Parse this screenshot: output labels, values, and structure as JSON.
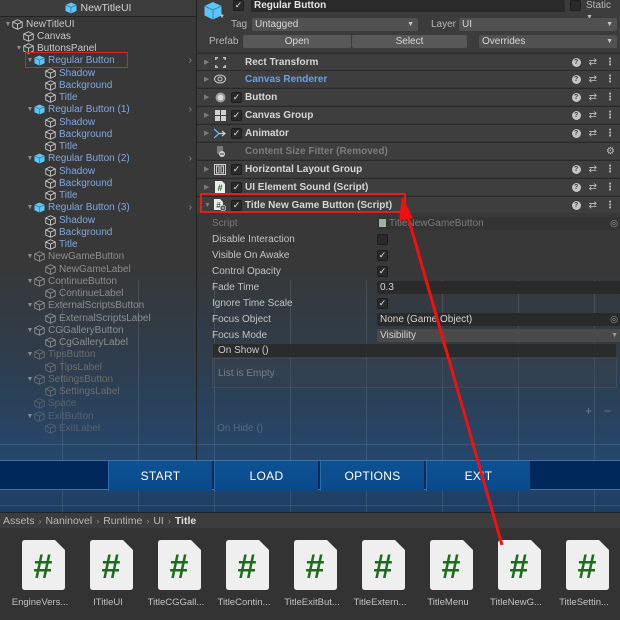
{
  "hierarchy": {
    "scene_title": "NewTitleUI",
    "items": [
      {
        "label": "NewTitleUI",
        "depth": 0,
        "arrow": true,
        "style": "normal"
      },
      {
        "label": "Canvas",
        "depth": 1,
        "arrow": false,
        "style": "normal"
      },
      {
        "label": "ButtonsPanel",
        "depth": 1,
        "arrow": true,
        "style": "normal"
      },
      {
        "label": "Regular Button",
        "depth": 2,
        "arrow": true,
        "style": "prefab",
        "chevron": true,
        "selected": true
      },
      {
        "label": "Shadow",
        "depth": 3,
        "arrow": false,
        "style": "prefab-child"
      },
      {
        "label": "Background",
        "depth": 3,
        "arrow": false,
        "style": "prefab-child"
      },
      {
        "label": "Title",
        "depth": 3,
        "arrow": false,
        "style": "prefab-child"
      },
      {
        "label": "Regular Button (1)",
        "depth": 2,
        "arrow": true,
        "style": "prefab",
        "chevron": true
      },
      {
        "label": "Shadow",
        "depth": 3,
        "arrow": false,
        "style": "prefab-child"
      },
      {
        "label": "Background",
        "depth": 3,
        "arrow": false,
        "style": "prefab-child"
      },
      {
        "label": "Title",
        "depth": 3,
        "arrow": false,
        "style": "prefab-child"
      },
      {
        "label": "Regular Button (2)",
        "depth": 2,
        "arrow": true,
        "style": "prefab",
        "chevron": true
      },
      {
        "label": "Shadow",
        "depth": 3,
        "arrow": false,
        "style": "prefab-child"
      },
      {
        "label": "Background",
        "depth": 3,
        "arrow": false,
        "style": "prefab-child"
      },
      {
        "label": "Title",
        "depth": 3,
        "arrow": false,
        "style": "prefab-child"
      },
      {
        "label": "Regular Button (3)",
        "depth": 2,
        "arrow": true,
        "style": "prefab",
        "chevron": true
      },
      {
        "label": "Shadow",
        "depth": 3,
        "arrow": false,
        "style": "prefab-child"
      },
      {
        "label": "Background",
        "depth": 3,
        "arrow": false,
        "style": "prefab-child"
      },
      {
        "label": "Title",
        "depth": 3,
        "arrow": false,
        "style": "prefab-child"
      },
      {
        "label": "NewGameButton",
        "depth": 2,
        "arrow": true,
        "style": "dim"
      },
      {
        "label": "NewGameLabel",
        "depth": 3,
        "arrow": false,
        "style": "dim"
      },
      {
        "label": "ContinueButton",
        "depth": 2,
        "arrow": true,
        "style": "dim"
      },
      {
        "label": "ContinueLabel",
        "depth": 3,
        "arrow": false,
        "style": "dim"
      },
      {
        "label": "ExternalScriptsButton",
        "depth": 2,
        "arrow": true,
        "style": "dim"
      },
      {
        "label": "ExternalScriptsLabel",
        "depth": 3,
        "arrow": false,
        "style": "dim"
      },
      {
        "label": "CGGalleryButton",
        "depth": 2,
        "arrow": true,
        "style": "dim"
      },
      {
        "label": "CgGalleryLabel",
        "depth": 3,
        "arrow": false,
        "style": "dim"
      },
      {
        "label": "TipsButton",
        "depth": 2,
        "arrow": true,
        "style": "dim2"
      },
      {
        "label": "TipsLabel",
        "depth": 3,
        "arrow": false,
        "style": "dim2"
      },
      {
        "label": "SettingsButton",
        "depth": 2,
        "arrow": true,
        "style": "dim2"
      },
      {
        "label": "SettingsLabel",
        "depth": 3,
        "arrow": false,
        "style": "dim2"
      },
      {
        "label": "Space",
        "depth": 2,
        "arrow": false,
        "style": "dim3"
      },
      {
        "label": "ExitButton",
        "depth": 2,
        "arrow": true,
        "style": "dim3"
      },
      {
        "label": "ExitLabel",
        "depth": 3,
        "arrow": false,
        "style": "dim3"
      }
    ]
  },
  "inspector": {
    "object_name": "Regular Button",
    "active": true,
    "static_label": "Static",
    "tag_label": "Tag",
    "tag_value": "Untagged",
    "layer_label": "Layer",
    "layer_value": "UI",
    "prefab_label": "Prefab",
    "prefab_open": "Open",
    "prefab_select": "Select",
    "prefab_overrides": "Overrides",
    "components": [
      {
        "title": "Rect Transform",
        "icon": "rect-transform-icon",
        "has_checkbox": false,
        "style": "normal"
      },
      {
        "title": "Canvas Renderer",
        "icon": "eye-icon",
        "has_checkbox": false,
        "style": "blue"
      },
      {
        "title": "Button",
        "icon": "button-icon",
        "has_checkbox": true,
        "style": "normal"
      },
      {
        "title": "Canvas Group",
        "icon": "grid-icon",
        "has_checkbox": true,
        "style": "normal"
      },
      {
        "title": "Animator",
        "icon": "animator-icon",
        "has_checkbox": true,
        "style": "normal"
      },
      {
        "title": "Content Size Fitter (Removed)",
        "icon": "removed-component-icon",
        "has_checkbox": false,
        "style": "removed"
      },
      {
        "title": "Horizontal Layout Group",
        "icon": "horizontal-layout-icon",
        "has_checkbox": true,
        "style": "normal"
      },
      {
        "title": "UI Element Sound (Script)",
        "icon": "script-icon",
        "has_checkbox": true,
        "style": "normal"
      },
      {
        "title": "Title New Game Button (Script)",
        "icon": "script-plus-icon",
        "has_checkbox": true,
        "style": "normal",
        "expanded": true,
        "highlighted": true
      }
    ],
    "properties": {
      "script_label": "Script",
      "script_value": "TitleNewGameButton",
      "disable_interaction_label": "Disable Interaction",
      "disable_interaction": false,
      "visible_on_awake_label": "Visible On Awake",
      "visible_on_awake": true,
      "control_opacity_label": "Control Opacity",
      "control_opacity": true,
      "fade_time_label": "Fade Time",
      "fade_time": "0.3",
      "ignore_time_scale_label": "Ignore Time Scale",
      "ignore_time_scale": true,
      "focus_object_label": "Focus Object",
      "focus_object": "None (Game Object)",
      "focus_mode_label": "Focus Mode",
      "focus_mode": "Visibility"
    },
    "events": {
      "on_show": "On Show ()",
      "list_empty": "List is Empty",
      "add": "+",
      "remove": "−",
      "on_hide": "On Hide ()"
    }
  },
  "game_view": {
    "buttons": [
      "START",
      "LOAD",
      "OPTIONS",
      "EXIT"
    ]
  },
  "project": {
    "breadcrumb": [
      "Assets",
      "Naninovel",
      "Runtime",
      "UI",
      "Title"
    ],
    "assets": [
      "EngineVers...",
      "ITitleUI",
      "TitleCGGall...",
      "TitleContin...",
      "TitleExitBut...",
      "TitleExtern...",
      "TitleMenu",
      "TitleNewG...",
      "TitleSettin..."
    ]
  },
  "colors": {
    "highlight_red": "#e0201c",
    "prefab_blue": "#7fa8e0",
    "cube_blue": "#5ec3f5",
    "script_green": "#1f6b1f",
    "game_button": "#0d5294"
  }
}
